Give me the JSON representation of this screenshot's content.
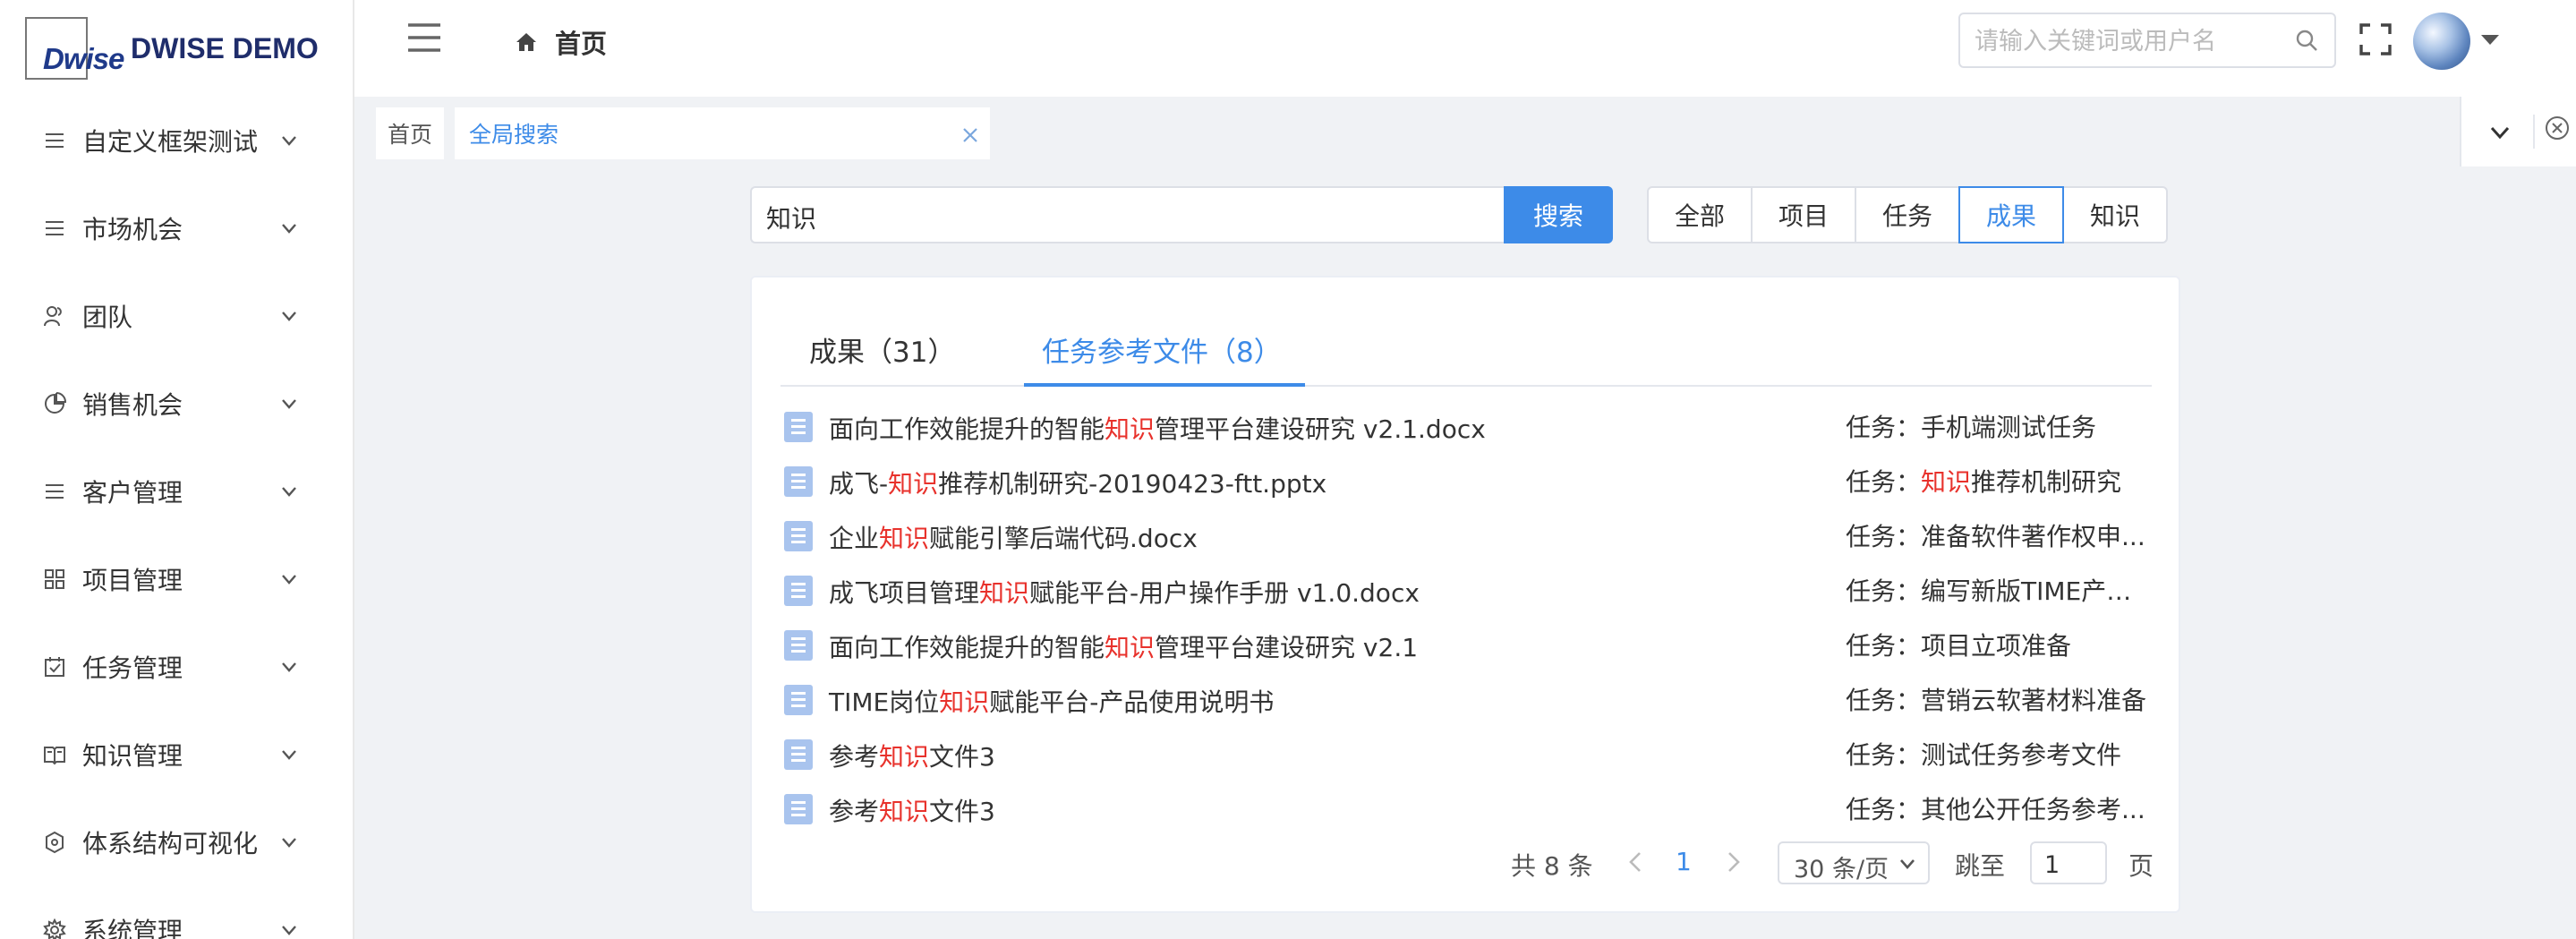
{
  "logo": {
    "mark": "Dwise",
    "title": "DWISE DEMO"
  },
  "sidebar": {
    "items": [
      {
        "label": "自定义框架测试",
        "icon": "list-icon"
      },
      {
        "label": "市场机会",
        "icon": "list-icon"
      },
      {
        "label": "团队",
        "icon": "team-icon"
      },
      {
        "label": "销售机会",
        "icon": "pie-chart-icon"
      },
      {
        "label": "客户管理",
        "icon": "list-icon"
      },
      {
        "label": "项目管理",
        "icon": "grid-icon"
      },
      {
        "label": "任务管理",
        "icon": "calendar-check-icon"
      },
      {
        "label": "知识管理",
        "icon": "book-icon"
      },
      {
        "label": "体系结构可视化",
        "icon": "network-icon"
      },
      {
        "label": "系统管理",
        "icon": "gear-icon"
      }
    ]
  },
  "header": {
    "breadcrumb": "首页",
    "search_placeholder": "请输入关键词或用户名"
  },
  "tags": {
    "home": "首页",
    "active": "全局搜索"
  },
  "search": {
    "query": "知识",
    "button": "搜索",
    "filters": [
      "全部",
      "项目",
      "任务",
      "成果",
      "知识"
    ],
    "active_filter": "成果"
  },
  "tabs": [
    {
      "label": "成果（31）"
    },
    {
      "label": "任务参考文件（8）"
    }
  ],
  "active_tab": "任务参考文件（8）",
  "highlight_color": "#e8322c",
  "accent_color": "#3d8be8",
  "results": [
    {
      "pre": "面向工作效能提升的智能",
      "hl": "知识",
      "post": "管理平台建设研究 v2.1.docx",
      "task_label": "任务：",
      "task_pre": "手机端测试任务",
      "task_hl": "",
      "task_post": ""
    },
    {
      "pre": "成飞-",
      "hl": "知识",
      "post": "推荐机制研究-20190423-ftt.pptx",
      "task_label": "任务：",
      "task_pre": "",
      "task_hl": "知识",
      "task_post": "推荐机制研究"
    },
    {
      "pre": "企业",
      "hl": "知识",
      "post": "赋能引擎后端代码.docx",
      "task_label": "任务：",
      "task_pre": "准备软件著作权申...",
      "task_hl": "",
      "task_post": ""
    },
    {
      "pre": "成飞项目管理",
      "hl": "知识",
      "post": "赋能平台-用户操作手册 v1.0.docx",
      "task_label": "任务：",
      "task_pre": "编写新版TIME产品...",
      "task_hl": "",
      "task_post": ""
    },
    {
      "pre": "面向工作效能提升的智能",
      "hl": "知识",
      "post": "管理平台建设研究 v2.1",
      "task_label": "任务：",
      "task_pre": "项目立项准备",
      "task_hl": "",
      "task_post": ""
    },
    {
      "pre": "TIME岗位",
      "hl": "知识",
      "post": "赋能平台-产品使用说明书",
      "task_label": "任务：",
      "task_pre": "营销云软著材料准备",
      "task_hl": "",
      "task_post": ""
    },
    {
      "pre": "参考",
      "hl": "知识",
      "post": "文件3",
      "task_label": "任务：",
      "task_pre": "测试任务参考文件",
      "task_hl": "",
      "task_post": ""
    },
    {
      "pre": "参考",
      "hl": "知识",
      "post": "文件3",
      "task_label": "任务：",
      "task_pre": "其他公开任务参考...",
      "task_hl": "",
      "task_post": ""
    }
  ],
  "pagination": {
    "total": "共 8 条",
    "current": "1",
    "page_size": "30 条/页",
    "jump_label": "跳至",
    "jump_value": "1",
    "unit": "页"
  }
}
